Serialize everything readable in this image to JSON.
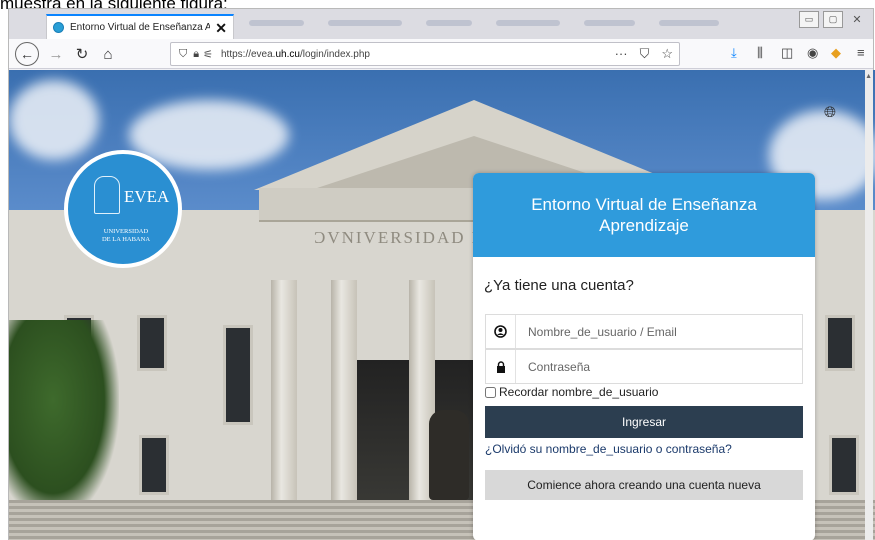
{
  "caption": "muestra en la siguiente figura:",
  "browser": {
    "tab_title": "Entorno Virtual de Enseñanza A",
    "tab_close": "✕",
    "url_prefix": "https://evea.",
    "url_domain": "uh.cu",
    "url_path": "/login/index.php",
    "more_dots": "···",
    "window_controls": [
      "▭",
      "▢",
      "✕"
    ]
  },
  "hero": {
    "logo_text": "EVEA",
    "logo_sub1": "UNIVERSIDAD",
    "logo_sub2": "DE LA HABANA",
    "building_inscription": "ƆVNIVERSIDAD DE"
  },
  "login": {
    "header": "Entorno Virtual de Enseñanza Aprendizaje",
    "question": "¿Ya tiene una cuenta?",
    "username_placeholder": "Nombre_de_usuario / Email",
    "password_placeholder": "Contraseña",
    "remember_label": "Recordar nombre_de_usuario",
    "remember_checked": false,
    "submit_label": "Ingresar",
    "forgot_link": "¿Olvidó su nombre_de_usuario o contraseña?",
    "signup_label": "Comience ahora creando una cuenta nueva"
  },
  "colors": {
    "header_blue": "#2f9bdc",
    "submit_dark": "#2c3e50",
    "link_blue": "#1b3a6b"
  }
}
